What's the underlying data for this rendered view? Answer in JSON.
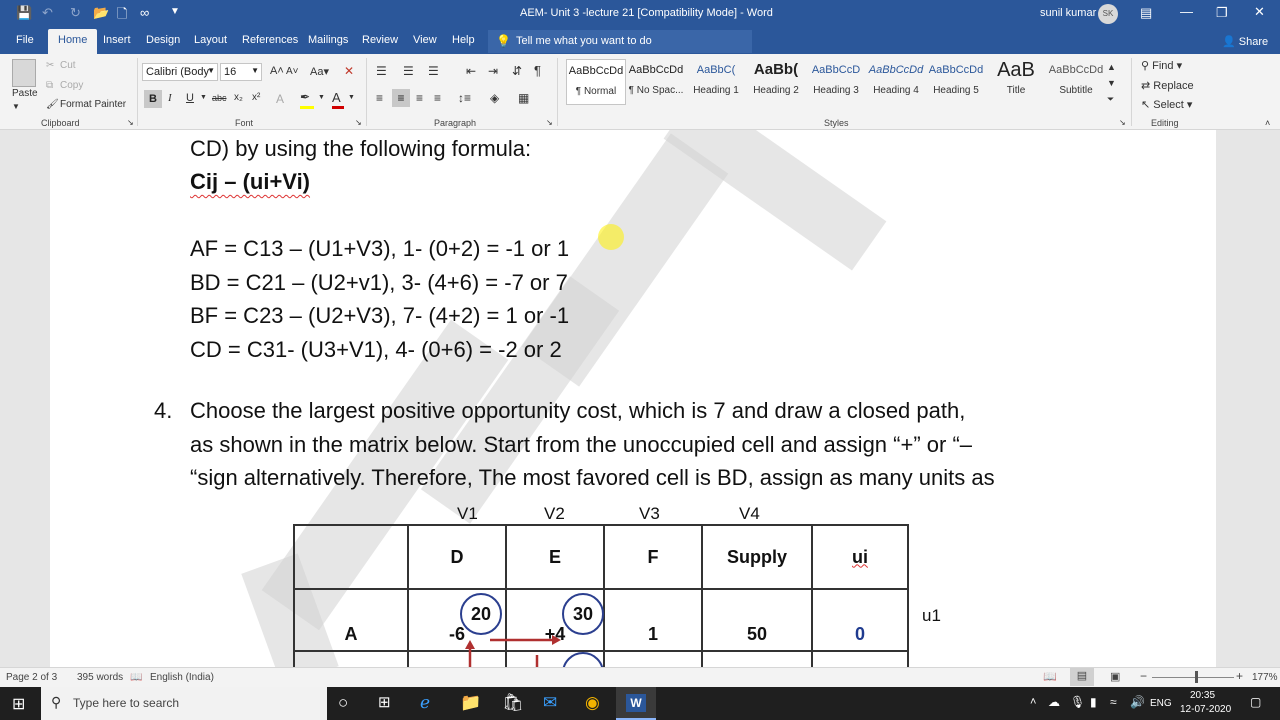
{
  "titlebar": {
    "title": "AEM- Unit 3 -lecture 21 [Compatibility Mode]  -  Word",
    "user": "sunil kumar",
    "avatar_initials": "SK"
  },
  "tabs": {
    "file": "File",
    "home": "Home",
    "insert": "Insert",
    "design": "Design",
    "layout": "Layout",
    "references": "References",
    "mailings": "Mailings",
    "review": "Review",
    "view": "View",
    "help": "Help",
    "tell_me": "Tell me what you want to do",
    "share": "Share"
  },
  "ribbon": {
    "clipboard": {
      "paste": "Paste",
      "cut": "Cut",
      "copy": "Copy",
      "format_painter": "Format Painter",
      "group": "Clipboard"
    },
    "font": {
      "name": "Calibri (Body",
      "size": "16",
      "bold": "B",
      "italic": "I",
      "underline": "U",
      "strike": "abc",
      "subscript": "x₂",
      "superscript": "x²",
      "group": "Font"
    },
    "paragraph": {
      "group": "Paragraph"
    },
    "styles": {
      "group": "Styles",
      "items": [
        {
          "preview": "AaBbCcDd",
          "label": "¶ Normal"
        },
        {
          "preview": "AaBbCcDd",
          "label": "¶ No Spac..."
        },
        {
          "preview": "AaBbC(",
          "label": "Heading 1"
        },
        {
          "preview": "AaBb(",
          "label": "Heading 2"
        },
        {
          "preview": "AaBbCcD",
          "label": "Heading 3"
        },
        {
          "preview": "AaBbCcDd",
          "label": "Heading 4"
        },
        {
          "preview": "AaBbCcDd",
          "label": "Heading 5"
        },
        {
          "preview": "AaB",
          "label": "Title"
        },
        {
          "preview": "AaBbCcDd",
          "label": "Subtitle"
        }
      ]
    },
    "editing": {
      "find": "Find",
      "replace": "Replace",
      "select": "Select",
      "group": "Editing"
    }
  },
  "document": {
    "line1": "CD) by using the following formula:",
    "formula": "Cij – (ui+Vi)",
    "calc": [
      "AF = C13 – (U1+V3),  1- (0+2) = -1 or 1",
      "BD = C21 – (U2+v1),   3- (4+6) = -7 or 7",
      "BF = C23 – (U2+V3),   7- (4+2) = 1 or -1",
      "CD = C31- (U3+V1),    4- (0+6) = -2 or 2"
    ],
    "step_number": "4.",
    "step_lines": [
      "Choose the largest positive opportunity cost, which is 7 and draw a closed path,",
      "as shown in the matrix below. Start from the unoccupied cell and assign “+” or “–",
      "“sign alternatively. Therefore, The most favored cell is BD, assign as many units as"
    ],
    "matrix": {
      "v_labels": [
        "V1",
        "V2",
        "V3",
        "V4"
      ],
      "headers": [
        "",
        "D",
        "E",
        "F",
        "Supply",
        "ui"
      ],
      "row_a": [
        "A",
        "-6",
        "+4",
        "1",
        "50",
        "0"
      ],
      "circle_values": [
        "20",
        "30"
      ],
      "u_label": "u1",
      "ui_color": "#1f3b8f"
    }
  },
  "statusbar": {
    "page": "Page 2 of 3",
    "words": "395 words",
    "language": "English (India)",
    "zoom": "177%"
  },
  "taskbar": {
    "search_placeholder": "Type here to search",
    "lang": "ENG",
    "time": "20:35",
    "date": "12-07-2020"
  },
  "colors": {
    "accent": "#2b579a",
    "taskbar": "#1f1f1f",
    "arrow": "#b03030"
  }
}
